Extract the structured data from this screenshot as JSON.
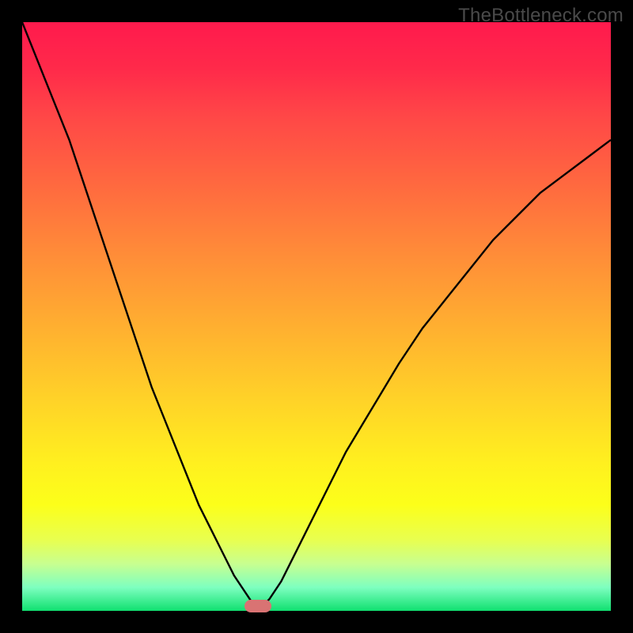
{
  "watermark": "TheBottleneck.com",
  "colors": {
    "frame_bg": "#000000",
    "curve_stroke": "#000000",
    "marker_fill": "#d97373",
    "gradient_top": "#ff1a4d",
    "gradient_bottom": "#10e070"
  },
  "chart_data": {
    "type": "line",
    "title": "",
    "xlabel": "",
    "ylabel": "",
    "xlim": [
      0,
      100
    ],
    "ylim": [
      0,
      100
    ],
    "grid": false,
    "legend": false,
    "annotations": [],
    "marker": {
      "x": 40,
      "y": 0,
      "shape": "pill"
    },
    "series": [
      {
        "name": "left-branch",
        "x": [
          0,
          2,
          4,
          6,
          8,
          10,
          12,
          14,
          16,
          18,
          20,
          22,
          24,
          26,
          28,
          30,
          32,
          34,
          36,
          38,
          39,
          40
        ],
        "y": [
          100,
          95,
          90,
          85,
          80,
          74,
          68,
          62,
          56,
          50,
          44,
          38,
          33,
          28,
          23,
          18,
          14,
          10,
          6,
          3,
          1.5,
          0.5
        ]
      },
      {
        "name": "right-branch",
        "x": [
          41,
          42,
          44,
          46,
          48,
          50,
          52,
          55,
          58,
          61,
          64,
          68,
          72,
          76,
          80,
          84,
          88,
          92,
          96,
          100
        ],
        "y": [
          1,
          2,
          5,
          9,
          13,
          17,
          21,
          27,
          32,
          37,
          42,
          48,
          53,
          58,
          63,
          67,
          71,
          74,
          77,
          80
        ]
      }
    ]
  }
}
